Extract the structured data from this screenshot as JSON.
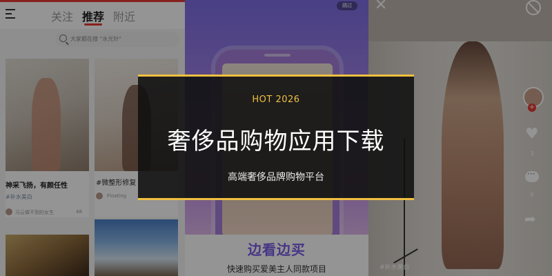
{
  "feed_app": {
    "tabs": [
      "关注",
      "推荐",
      "附近"
    ],
    "search_placeholder": "大家都在搜 \"水光针\"",
    "cards": [
      {
        "title": "神采飞扬，有颜任性",
        "tag": "#补水美白",
        "user": "马云做不到的女生",
        "likes": "48"
      },
      {
        "title": "#微整形修复",
        "user": "Floating"
      }
    ]
  },
  "promo_app": {
    "skip_label": "跳过",
    "headline": "边看边买",
    "subline": "快速购买爱美主人同款项目"
  },
  "video_app": {
    "like_count": "3",
    "comment_count": "0",
    "tag": "#补水美白"
  },
  "banner": {
    "label": "HOT 2026",
    "title": "奢侈品购物应用下载",
    "subtitle": "高端奢侈品牌购物平台",
    "accent_color": "#f0c040"
  }
}
